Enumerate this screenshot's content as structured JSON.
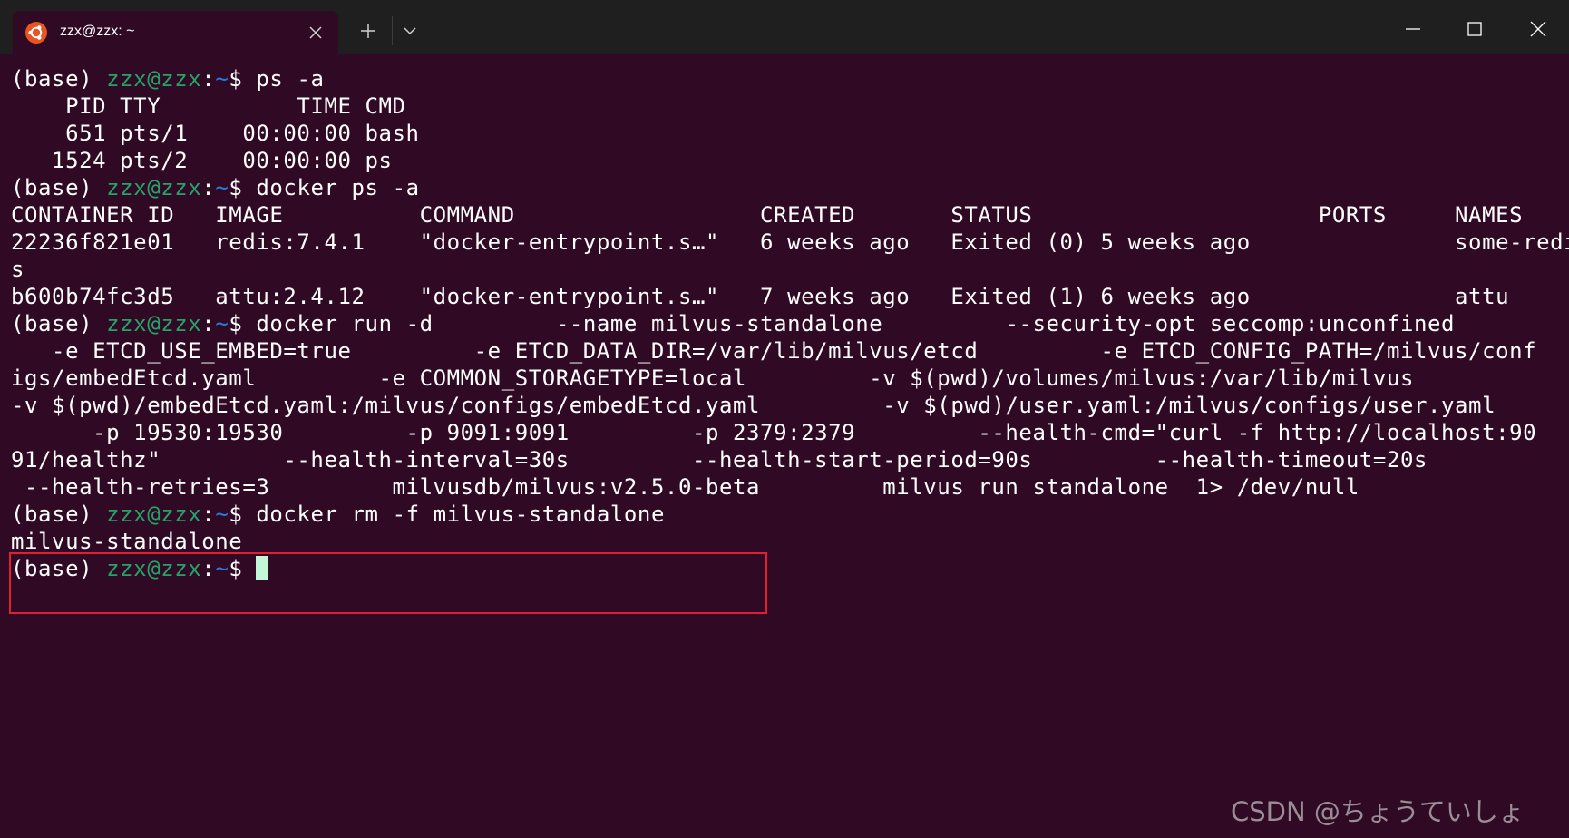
{
  "window": {
    "tab_title": "zzx@zzx: ~",
    "new_tab_icon": "plus-icon",
    "dropdown_icon": "chevron-down-icon",
    "controls": [
      "minimize-icon",
      "maximize-icon",
      "close-icon"
    ]
  },
  "prompt": {
    "env": "(base) ",
    "user_host": "zzx@zzx",
    "colon": ":",
    "path": "~",
    "symbol": "$ "
  },
  "terminal": {
    "cmd1": "ps -a",
    "ps_output": [
      "    PID TTY          TIME CMD",
      "    651 pts/1    00:00:00 bash",
      "   1524 pts/2    00:00:00 ps"
    ],
    "cmd2": "docker ps -a",
    "docker_ps_output": [
      "CONTAINER ID   IMAGE          COMMAND                  CREATED       STATUS                     PORTS     NAMES",
      "22236f821e01   redis:7.4.1    \"docker-entrypoint.s…\"   6 weeks ago   Exited (0) 5 weeks ago               some-redi",
      "s",
      "b600b74fc3d5   attu:2.4.12    \"docker-entrypoint.s…\"   7 weeks ago   Exited (1) 6 weeks ago               attu"
    ],
    "cmd3": "docker run -d         --name milvus-standalone         --security-opt seccomp:unconfined",
    "cmd3_wrapped": [
      "   -e ETCD_USE_EMBED=true         -e ETCD_DATA_DIR=/var/lib/milvus/etcd         -e ETCD_CONFIG_PATH=/milvus/conf",
      "igs/embedEtcd.yaml         -e COMMON_STORAGETYPE=local         -v $(pwd)/volumes/milvus:/var/lib/milvus",
      "-v $(pwd)/embedEtcd.yaml:/milvus/configs/embedEtcd.yaml         -v $(pwd)/user.yaml:/milvus/configs/user.yaml",
      "      -p 19530:19530         -p 9091:9091         -p 2379:2379         --health-cmd=\"curl -f http://localhost:90",
      "91/healthz\"         --health-interval=30s         --health-start-period=90s         --health-timeout=20s",
      " --health-retries=3         milvusdb/milvus:v2.5.0-beta         milvus run standalone  1> /dev/null"
    ],
    "cmd4": "docker rm -f milvus-standalone",
    "cmd4_output": "milvus-standalone"
  },
  "watermark": "CSDN @ちょうていしょ",
  "colors": {
    "background": "#300a24",
    "titlebar": "#1f1f1f",
    "user_host": "#26a269",
    "path": "#2a7bde",
    "highlight_box": "#e02030",
    "cursor": "#c4f5d6"
  }
}
